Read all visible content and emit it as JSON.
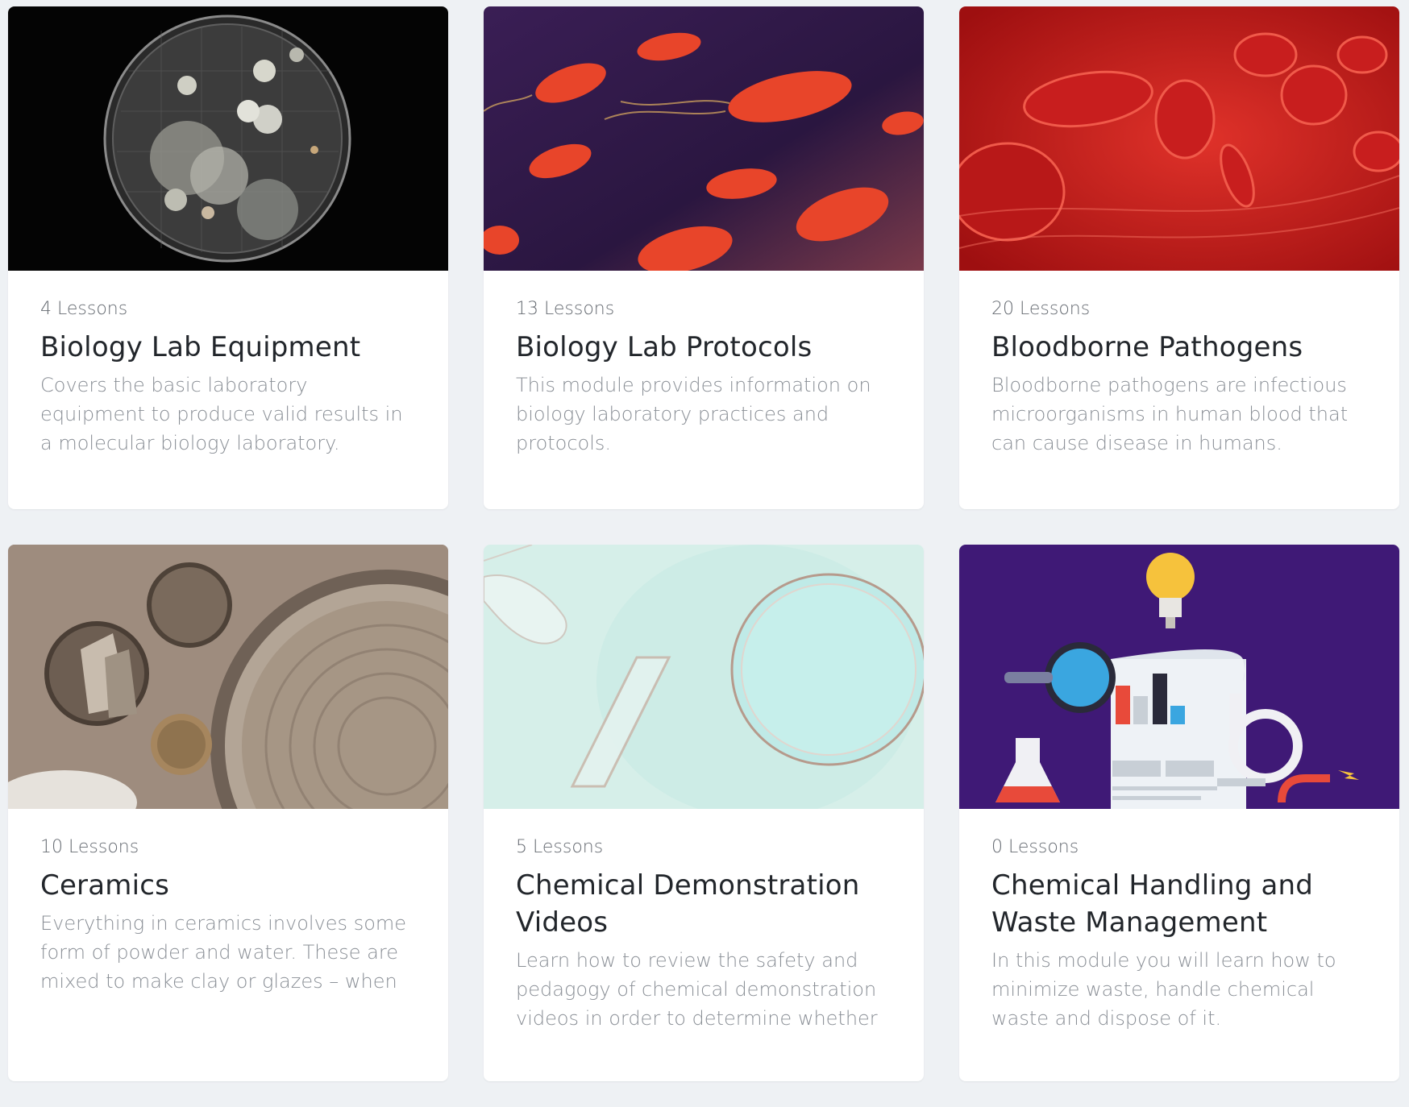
{
  "courses": [
    {
      "lessons": "4 Lessons",
      "title": "Biology Lab Equipment",
      "description": "Covers the basic laboratory equipment to produce valid results in a molecular biology laboratory.",
      "image": "petri-dish-cultures-image"
    },
    {
      "lessons": "13 Lessons",
      "title": "Biology Lab Protocols",
      "description": "This module provides information on biology laboratory practices and protocols.",
      "image": "bacteria-illustration-image"
    },
    {
      "lessons": "20 Lessons",
      "title": "Bloodborne Pathogens",
      "description": "Bloodborne pathogens are infectious microorganisms in human blood that can cause disease in humans.",
      "image": "red-blood-cells-image"
    },
    {
      "lessons": "10 Lessons",
      "title": "Ceramics",
      "description": "Everything in ceramics involves some form of powder and water. These are mixed to make clay or glazes – when they",
      "image": "pottery-wheel-image"
    },
    {
      "lessons": "5 Lessons",
      "title": "Chemical Demonstration Videos",
      "description": "Learn how to review the safety and pedagogy of chemical demonstration videos in order to determine whether they should be used in the classroom.",
      "image": "test-tube-and-petri-dish-image"
    },
    {
      "lessons": "0 Lessons",
      "title": "Chemical Handling and Waste Management",
      "description": "In this module you will learn how to minimize waste, handle chemical waste and dispose of it.",
      "image": "lab-report-illustration-image"
    }
  ]
}
